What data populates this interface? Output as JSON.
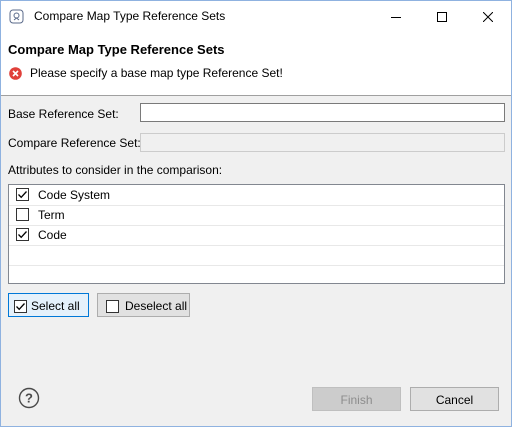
{
  "window": {
    "title": "Compare Map Type Reference Sets"
  },
  "header": {
    "title": "Compare Map Type Reference Sets",
    "message": "Please specify a base map type Reference Set!"
  },
  "form": {
    "base_label": "Base Reference Set:",
    "base_value": "",
    "compare_label": "Compare Reference Set:",
    "compare_value": "",
    "attributes_label": "Attributes to consider in the comparison:"
  },
  "attributes": [
    {
      "label": "Code System",
      "checked": true
    },
    {
      "label": "Term",
      "checked": false
    },
    {
      "label": "Code",
      "checked": true
    }
  ],
  "buttons": {
    "select_all": "Select all",
    "deselect_all": "Deselect all",
    "finish": "Finish",
    "cancel": "Cancel"
  },
  "colors": {
    "error": "#e0403a",
    "accent": "#0078d7",
    "disabled_text": "#8d8d8d"
  }
}
